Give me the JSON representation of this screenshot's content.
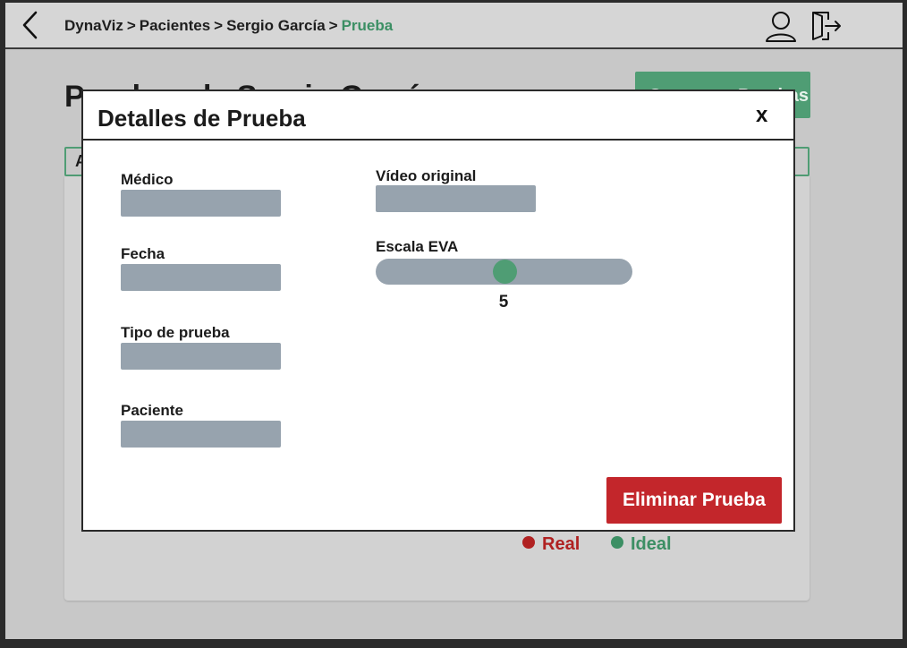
{
  "header": {
    "breadcrumb": [
      "DynaViz",
      "Pacientes",
      "Sergio García",
      "Prueba"
    ],
    "separator": ">"
  },
  "background": {
    "page_title": "Pruebas de Sergio García",
    "green_button_label": "Comparar Pruebas",
    "tab_label": "A",
    "legend": {
      "real": "Real",
      "ideal": "Ideal"
    }
  },
  "modal": {
    "title": "Detalles de Prueba",
    "close_label": "x",
    "fields": {
      "medico": "Médico",
      "fecha": "Fecha",
      "tipo": "Tipo de prueba",
      "paciente": "Paciente",
      "video": "Vídeo original",
      "escala": "Escala EVA"
    },
    "eva": {
      "value": 5,
      "min": 0,
      "max": 10,
      "display": "5"
    },
    "delete_label": "Eliminar Prueba"
  },
  "colors": {
    "accent_green": "#4f9d74",
    "danger_red": "#c3262b",
    "placeholder_gray": "#97a3ae",
    "real_red": "#b02121",
    "ideal_green": "#3c8f64"
  },
  "icons": {
    "back": "chevron-left-icon",
    "user": "user-icon",
    "logout": "logout-icon"
  }
}
